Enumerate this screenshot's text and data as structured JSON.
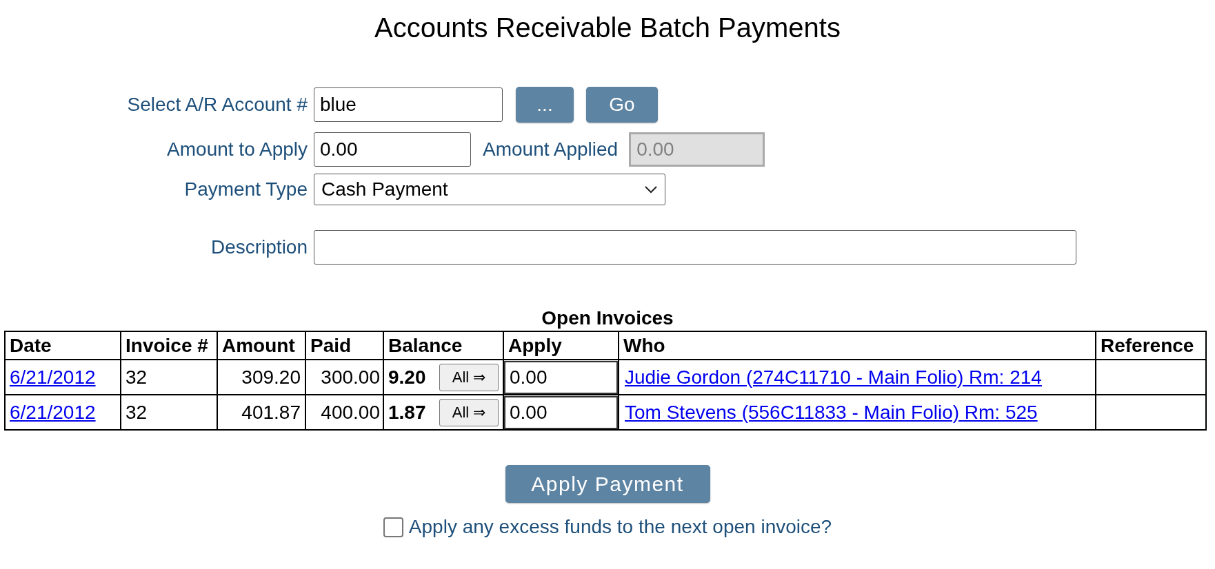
{
  "title": "Accounts Receivable Batch Payments",
  "form": {
    "account": {
      "label": "Select A/R Account #",
      "value": "blue",
      "lookup_button": "...",
      "go_button": "Go"
    },
    "amount_to_apply": {
      "label": "Amount to Apply",
      "value": "0.00"
    },
    "amount_applied": {
      "label": "Amount Applied",
      "value": "0.00",
      "disabled": true
    },
    "payment_type": {
      "label": "Payment Type",
      "value": "Cash Payment"
    },
    "description": {
      "label": "Description"
    }
  },
  "invoices": {
    "title": "Open Invoices",
    "columns": [
      "Date",
      "Invoice #",
      "Amount",
      "Paid",
      "Balance",
      "Apply",
      "Who",
      "Reference"
    ],
    "rows": [
      {
        "date": "6/21/2012",
        "invoice": "32",
        "amount": "309.20",
        "paid": "300.00",
        "balance": "9.20",
        "all_button": "All ⇒",
        "apply": "0.00",
        "who": "Judie Gordon (274C11710 - Main Folio) Rm: 214"
      },
      {
        "date": "6/21/2012",
        "invoice": "32",
        "amount": "401.87",
        "paid": "400.00",
        "balance": "1.87",
        "all_button": "All ⇒",
        "apply": "0.00",
        "who": "Tom Stevens (556C11833 - Main Folio) Rm: 525"
      }
    ]
  },
  "apply_button": "Apply Payment",
  "excess": {
    "label": "Apply any excess funds to the next open invoice?",
    "checked": false
  }
}
